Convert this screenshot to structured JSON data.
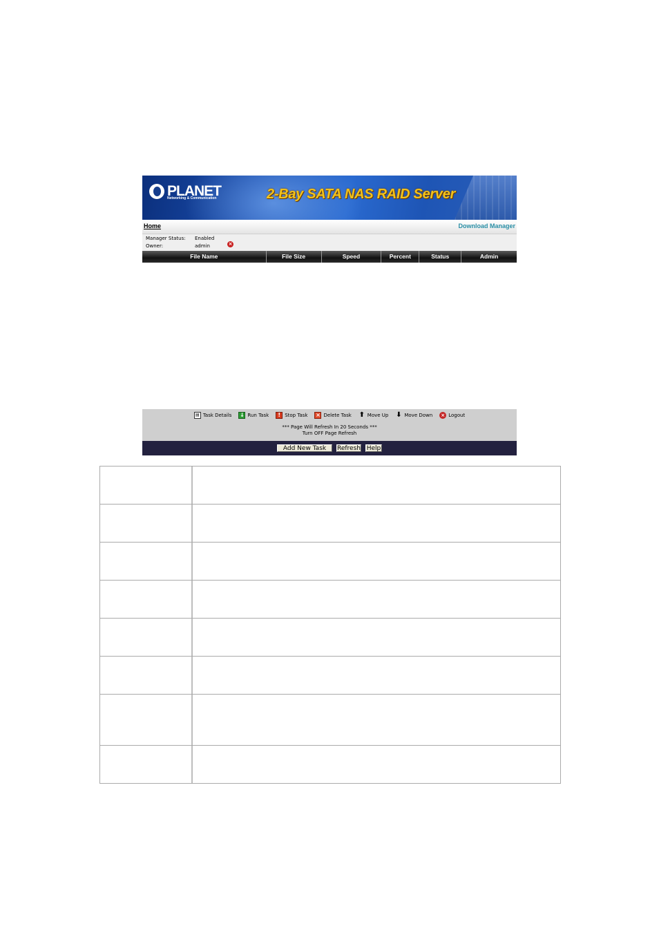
{
  "header": {
    "logo_text": "PLANET",
    "logo_subtext": "Networking & Communication",
    "product_title": "2-Bay SATA NAS RAID Server"
  },
  "nav": {
    "home_label": "Home",
    "page_label": "Download Manager"
  },
  "info": {
    "status_label": "Manager Status:",
    "status_value": "Enabled",
    "owner_label": "Owner:",
    "owner_value": "admin"
  },
  "table": {
    "columns": [
      "File Name",
      "File Size",
      "Speed",
      "Percent",
      "Status",
      "Admin"
    ],
    "rows": []
  },
  "legend": {
    "items": [
      {
        "label": "Task Details",
        "icon": "task-details-icon"
      },
      {
        "label": "Run Task",
        "icon": "run-task-icon"
      },
      {
        "label": "Stop Task",
        "icon": "stop-task-icon"
      },
      {
        "label": "Delete Task",
        "icon": "delete-task-icon"
      },
      {
        "label": "Move Up",
        "icon": "move-up-icon"
      },
      {
        "label": "Move Down",
        "icon": "move-down-icon"
      },
      {
        "label": "Logout",
        "icon": "logout-icon"
      }
    ],
    "refresh_message": "*** Page Will Refresh In 20 Seconds ***",
    "refresh_toggle": "Turn OFF Page Refresh"
  },
  "footer": {
    "add_label": "Add New Task",
    "refresh_label": "Refresh",
    "help_label": "Help"
  },
  "colors": {
    "accent": "#2a8fa6",
    "footer_bg": "#23213f",
    "header_bar": "#111111"
  }
}
